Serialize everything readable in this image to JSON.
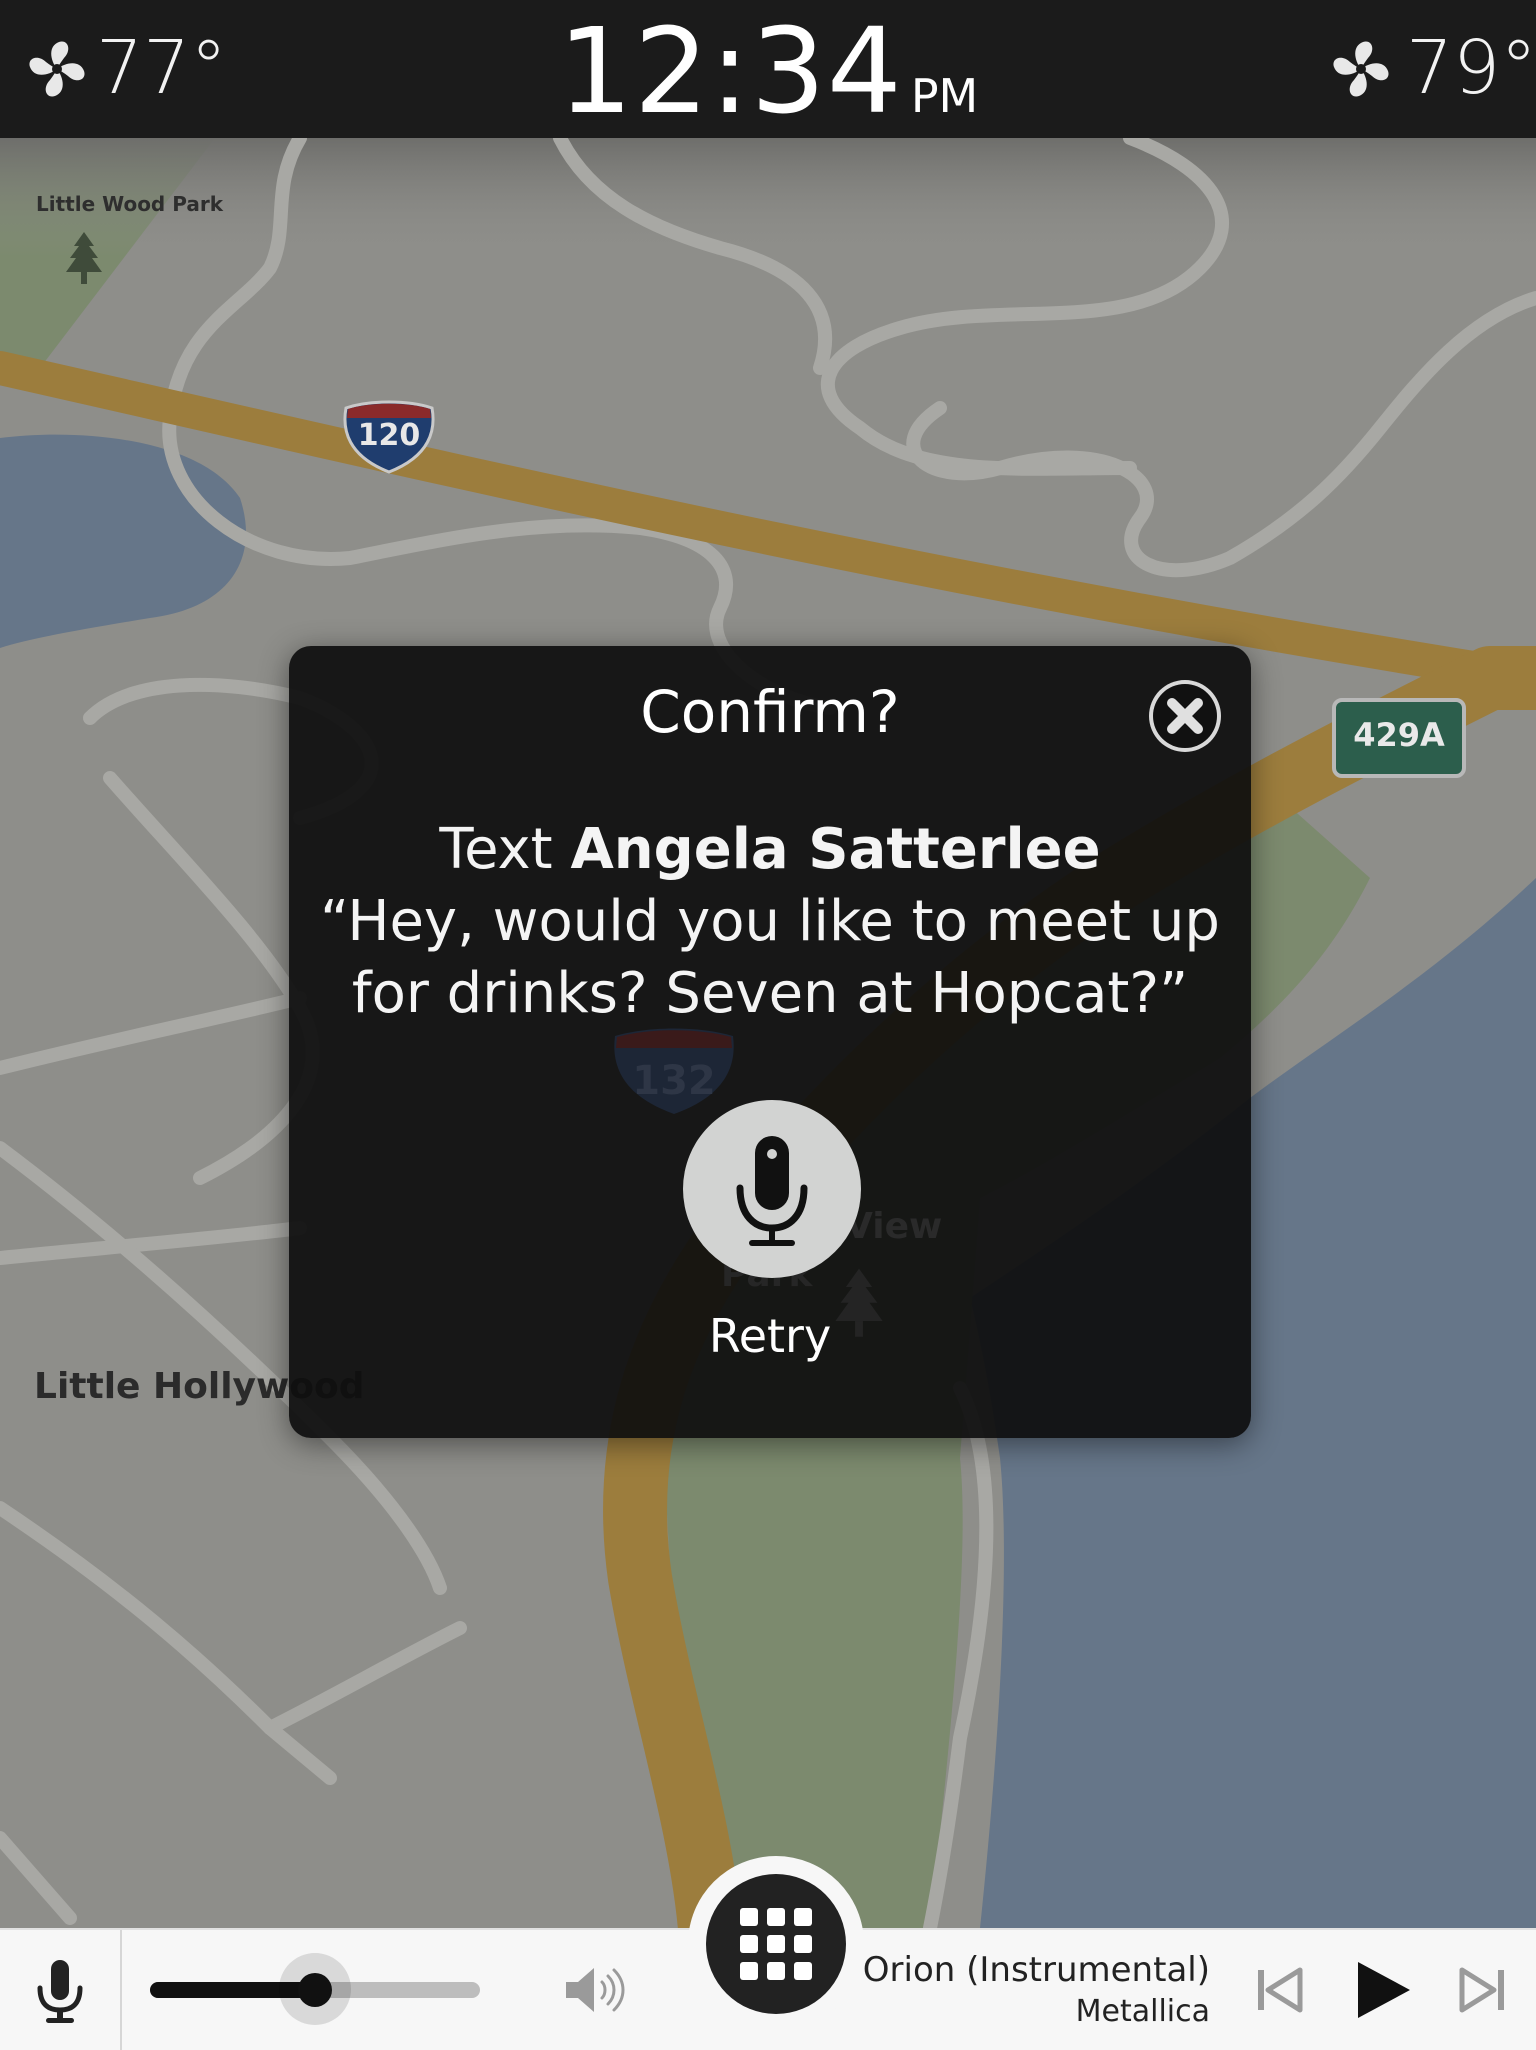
{
  "status": {
    "left_temp": "77°",
    "right_temp": "79°",
    "time": "12:34",
    "ampm": "PM"
  },
  "map": {
    "labels": {
      "park_top": "Little Wood Park",
      "neighborhood": "Little Hollywood",
      "park_center_a": "View",
      "park_center_b": "Park"
    },
    "shields": {
      "interstate_a": "120",
      "interstate_b": "132",
      "exit": "429A"
    },
    "colors": {
      "land": "#8e8e8a",
      "water": "#667689",
      "park": "#7c8a6e",
      "highway": "#9c7d3d",
      "road": "#a3a3a0"
    }
  },
  "dialog": {
    "title": "Confirm?",
    "prefix": "Text",
    "recipient": "Angela Satterlee",
    "message_line1": "“Hey, would you like to meet up",
    "message_line2": "for drinks? Seven at Hopcat?”",
    "retry_label": "Retry",
    "close_icon": "close-icon",
    "mic_icon": "microphone-icon"
  },
  "player": {
    "volume": 0.5,
    "track_title": "Orion (Instrumental)",
    "artist": "Metallica",
    "icons": [
      "microphone-icon",
      "volume-icon",
      "grid-icon",
      "skip-previous-icon",
      "play-icon",
      "skip-next-icon"
    ]
  }
}
